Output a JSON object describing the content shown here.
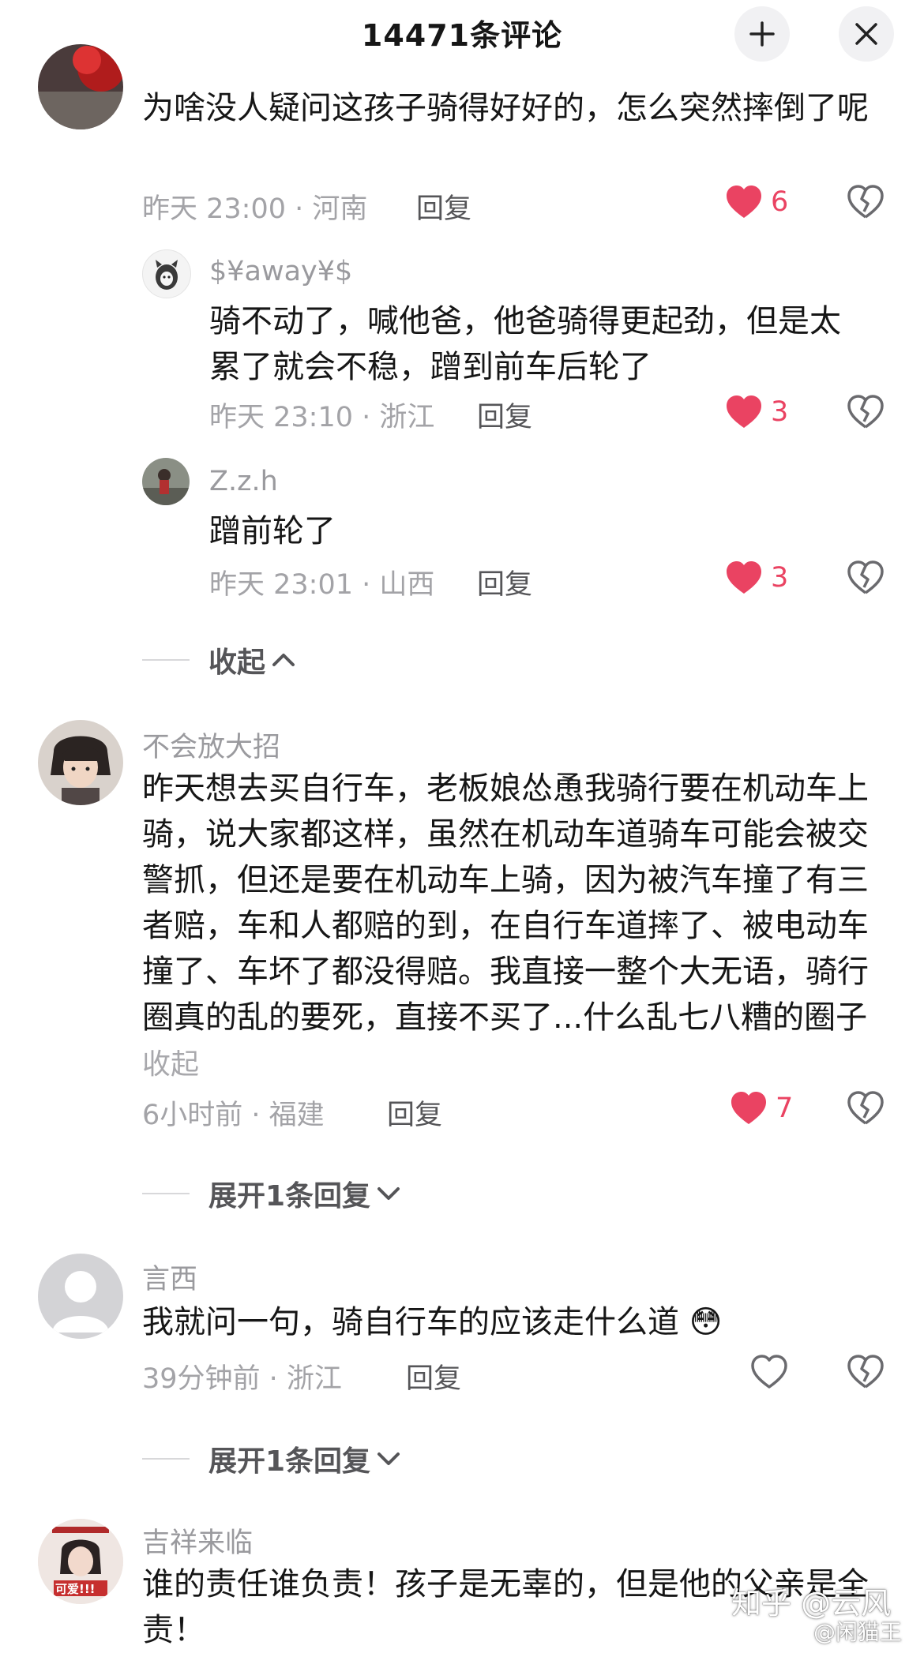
{
  "header": {
    "title": "14471条评论"
  },
  "comments": [
    {
      "name": "",
      "text": "为啥没人疑问这孩子骑得好好的，怎么突然摔倒了呢",
      "time_loc": "昨天 23:00 · 河南",
      "reply": "回复",
      "likes": "6"
    },
    {
      "name": "$¥away¥$",
      "text": "骑不动了，喊他爸，他爸骑得更起劲，但是太累了就会不稳，蹭到前车后轮了",
      "time_loc": "昨天 23:10 · 浙江",
      "reply": "回复",
      "likes": "3"
    },
    {
      "name": "Z.z.h",
      "text": "蹭前轮了",
      "time_loc": "昨天 23:01 · 山西",
      "reply": "回复",
      "likes": "3"
    },
    {
      "name": "不会放大招",
      "text": "昨天想去买自行车，老板娘怂恿我骑行要在机动车上骑，说大家都这样，虽然在机动车道骑车可能会被交警抓，但还是要在机动车上骑，因为被汽车撞了有三者赔，车和人都赔的到，在自行车道摔了、被电动车撞了、车坏了都没得赔。我直接一整个大无语，骑行圈真的乱的要死，直接不买了...什么乱七八糟的圈子",
      "collapse": "收起",
      "time_loc": "6小时前 · 福建",
      "reply": "回复",
      "likes": "7"
    },
    {
      "name": "言西",
      "text": "我就问一句，骑自行车的应该走什么道",
      "emoji": "😳",
      "time_loc": "39分钟前 · 浙江",
      "reply": "回复",
      "likes": ""
    },
    {
      "name": "吉祥来临",
      "text": "谁的责任谁负责！孩子是无辜的，但是他的父亲是全责！"
    }
  ],
  "fold": {
    "collapse": "收起",
    "expand1": "展开1条回复",
    "expand2": "展开1条回复"
  },
  "avatar4_text": "可爱!!!",
  "watermark": {
    "line1": "知乎 @云风",
    "line2": "@闲猫王"
  },
  "colors": {
    "like_red": "#ea4362",
    "meta_gray": "#a3a3a7"
  }
}
